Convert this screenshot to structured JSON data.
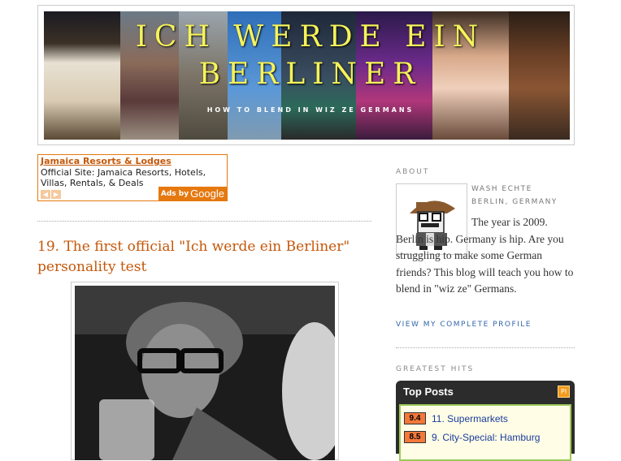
{
  "header": {
    "title": "ICH WERDE EIN BERLINER",
    "subtitle": "HOW TO BLEND IN WIZ ZE GERMANS"
  },
  "ad": {
    "title": "Jamaica Resorts & Lodges",
    "text": "Official Site: Jamaica Resorts, Hotels, Villas, Rentals, & Deals",
    "prev_icon": "prev-arrow-icon",
    "next_icon": "next-arrow-icon",
    "badge_prefix": "Ads by",
    "badge_brand": "Google"
  },
  "post": {
    "title": "19. The first official \"Ich werde ein Berliner\" personality test"
  },
  "sidebar": {
    "about_heading": "ABOUT",
    "author_name": "WASH ECHTE",
    "author_location": "BERLIN, GERMANY",
    "about_text": "The year is 2009. Berlin is hip. Germany is hip. Are you struggling to make some German friends? This blog will teach you how to blend in \"wiz ze\" Germans.",
    "profile_link": "VIEW MY COMPLETE PROFILE",
    "hits_heading": "GREATEST HITS"
  },
  "top_posts": {
    "title": "Top Posts",
    "icon": "rss-badge-icon",
    "items": [
      {
        "score": "9.4",
        "label": "11. Supermarkets"
      },
      {
        "score": "8.5",
        "label": "9. City-Special: Hamburg"
      }
    ]
  },
  "colors": {
    "accent": "#c4570a",
    "banner_title": "#f6f35a",
    "link": "#3366aa"
  }
}
